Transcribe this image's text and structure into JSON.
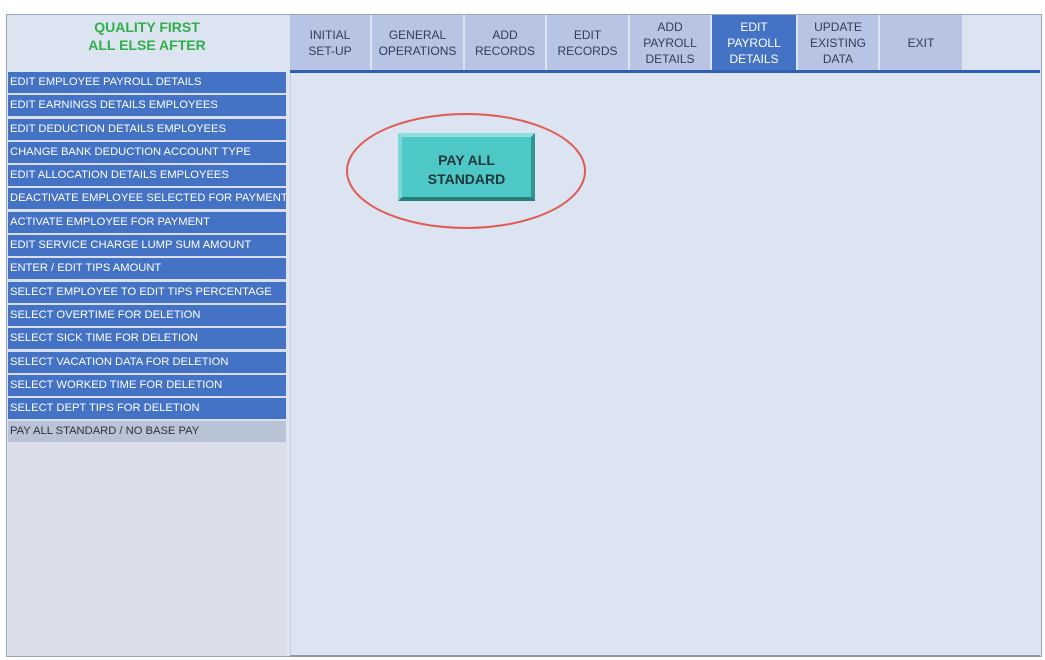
{
  "brand": {
    "line1": "QUALITY FIRST",
    "line2": "ALL ELSE AFTER"
  },
  "topnav": {
    "tabs": [
      {
        "label": "INITIAL\nSET-UP",
        "active": false
      },
      {
        "label": "GENERAL\nOPERATIONS",
        "active": false
      },
      {
        "label": "ADD\nRECORDS",
        "active": false
      },
      {
        "label": "EDIT\nRECORDS",
        "active": false
      },
      {
        "label": "ADD PAYROLL\nDETAILS",
        "active": false
      },
      {
        "label": "EDIT PAYROLL\nDETAILS",
        "active": true
      },
      {
        "label": "UPDATE\nEXISTING\nDATA",
        "active": false
      },
      {
        "label": "EXIT",
        "active": false
      }
    ]
  },
  "sidebar": {
    "items": [
      {
        "label": "EDIT EMPLOYEE PAYROLL DETAILS"
      },
      {
        "label": "EDIT EARNINGS DETAILS EMPLOYEES"
      },
      {
        "label": "EDIT DEDUCTION DETAILS EMPLOYEES"
      },
      {
        "label": "CHANGE BANK DEDUCTION ACCOUNT TYPE"
      },
      {
        "label": "EDIT ALLOCATION DETAILS EMPLOYEES"
      },
      {
        "label": "DEACTIVATE EMPLOYEE SELECTED FOR PAYMENT"
      },
      {
        "label": "ACTIVATE EMPLOYEE FOR PAYMENT"
      },
      {
        "label": "EDIT SERVICE CHARGE LUMP SUM AMOUNT"
      },
      {
        "label": "ENTER / EDIT TIPS AMOUNT"
      },
      {
        "label": "SELECT EMPLOYEE TO EDIT TIPS PERCENTAGE"
      },
      {
        "label": "SELECT OVERTIME FOR DELETION"
      },
      {
        "label": "SELECT SICK TIME FOR DELETION"
      },
      {
        "label": "SELECT VACATION DATA FOR DELETION"
      },
      {
        "label": "SELECT WORKED TIME FOR DELETION"
      },
      {
        "label": "SELECT DEPT TIPS FOR DELETION"
      },
      {
        "label": "PAY ALL STANDARD / NO BASE PAY"
      }
    ]
  },
  "main": {
    "pay_button": {
      "line1": "PAY ALL",
      "line2": "STANDARD"
    }
  },
  "colors": {
    "brand_text": "#31b04a",
    "nav_active": "#4472c4",
    "nav_inactive": "#b7c4e3",
    "sidebar_item": "#4472c4",
    "pay_button": "#4ec8c6",
    "highlight_ring": "#e05a52"
  }
}
